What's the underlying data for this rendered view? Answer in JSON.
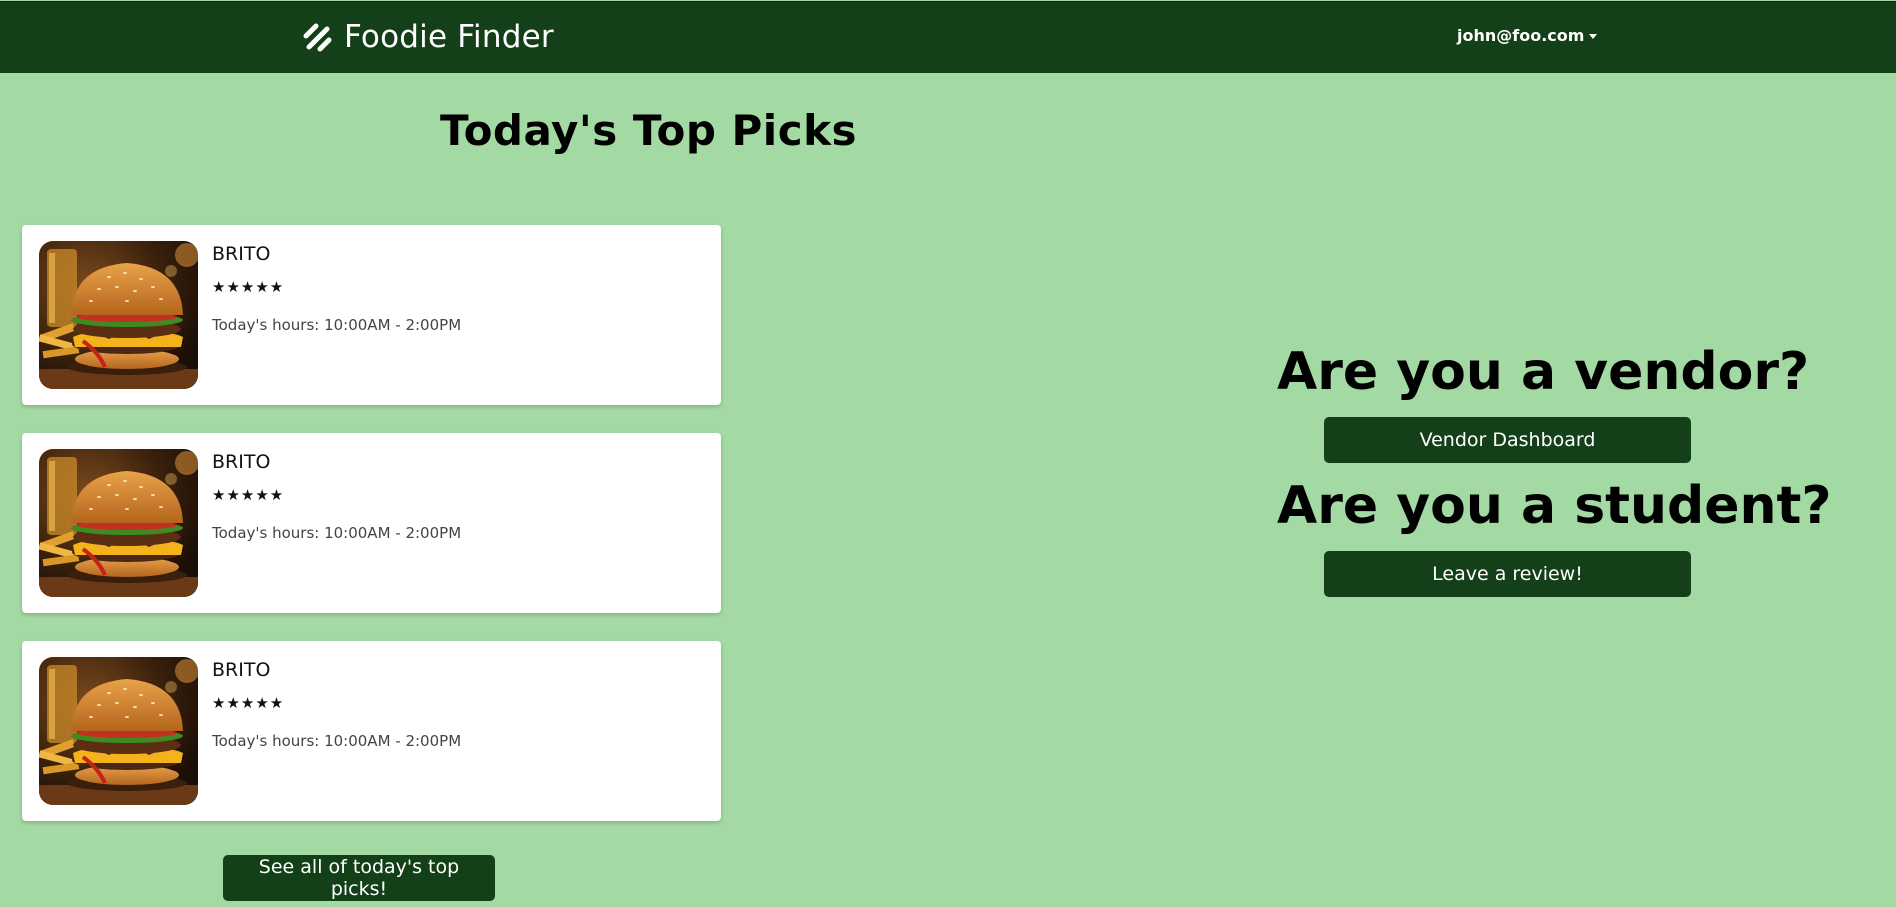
{
  "navbar": {
    "brand": "Foodie Finder",
    "brand_icon": "hotdog-logo-icon",
    "user_email": "john@foo.com",
    "user_menu_icon": "caret-down-icon",
    "color": "#134018"
  },
  "main": {
    "title": "Today's Top Picks",
    "picks": [
      {
        "name": "BRITO",
        "stars": "★★★★★",
        "rating": 5,
        "hours": "Today's hours: 10:00AM - 2:00PM",
        "image": "burger-photo"
      },
      {
        "name": "BRITO",
        "stars": "★★★★★",
        "rating": 5,
        "hours": "Today's hours: 10:00AM - 2:00PM",
        "image": "burger-photo"
      },
      {
        "name": "BRITO",
        "stars": "★★★★★",
        "rating": 5,
        "hours": "Today's hours: 10:00AM - 2:00PM",
        "image": "burger-photo"
      }
    ],
    "see_all_label": "See all of today's top picks!"
  },
  "sidebar": {
    "vendor_heading": "Are you a vendor?",
    "vendor_button": "Vendor Dashboard",
    "student_heading": "Are you a student?",
    "student_button": "Leave a review!"
  },
  "colors": {
    "background": "#a3d9a3",
    "primary": "#134018",
    "card": "#ffffff"
  }
}
